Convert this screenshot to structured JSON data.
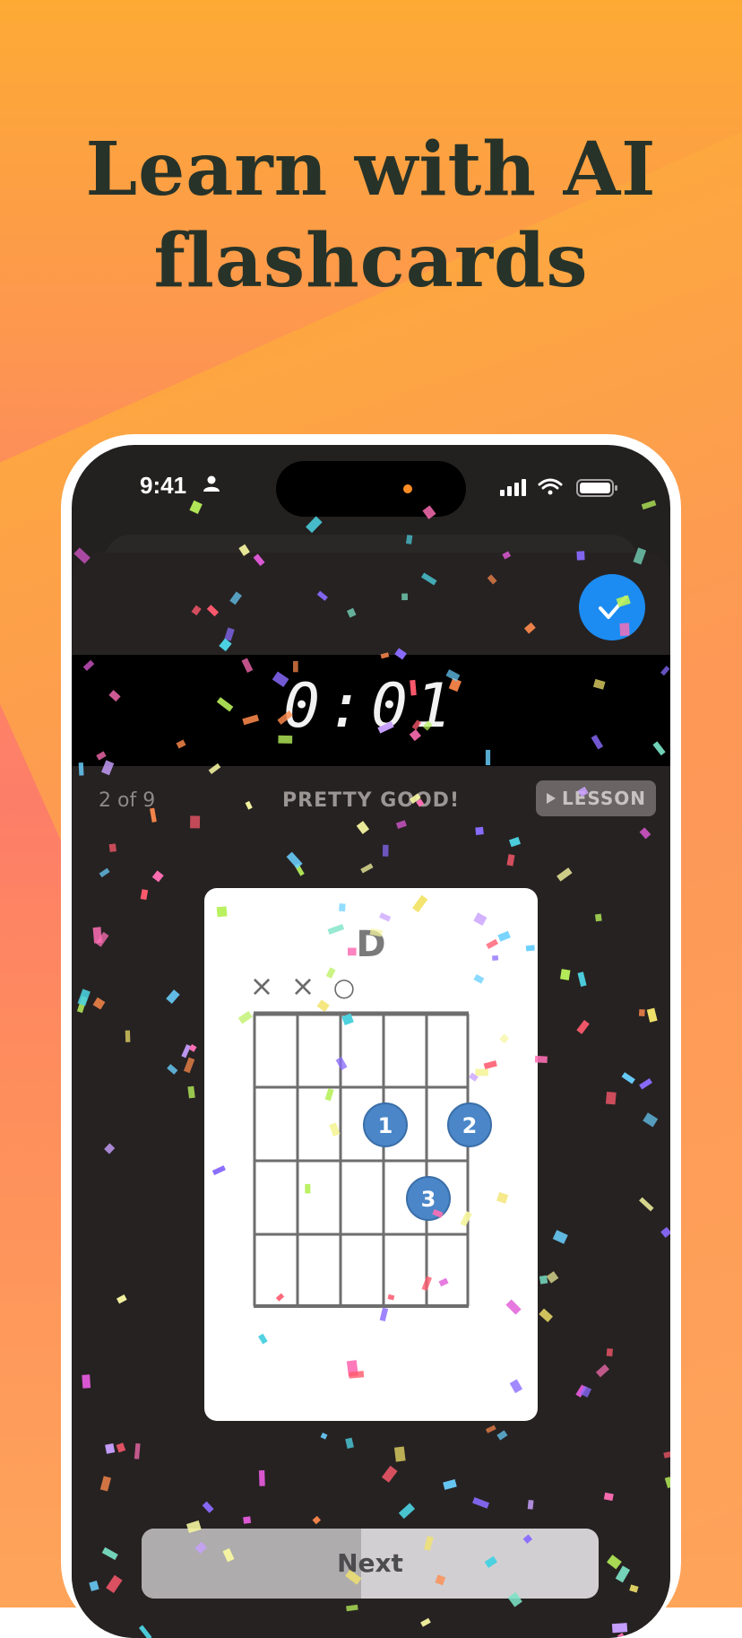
{
  "headline": {
    "line1": "Learn with AI",
    "line2": "flashcards"
  },
  "status_bar": {
    "time": "9:41"
  },
  "timer": "0:01",
  "progress_text": "2 of 9",
  "feedback_text": "PRETTY GOOD!",
  "lesson_button": {
    "label": "LESSON"
  },
  "chord": {
    "name": "D",
    "string_markers": [
      "×",
      "×",
      "○"
    ],
    "fingers": [
      "1",
      "2",
      "3"
    ]
  },
  "next_button": {
    "label": "Next",
    "progress": 0.48
  },
  "colors": {
    "accent_blue": "#1c8cf2",
    "finger_dot": "#4a86c8",
    "headline": "#273329"
  }
}
